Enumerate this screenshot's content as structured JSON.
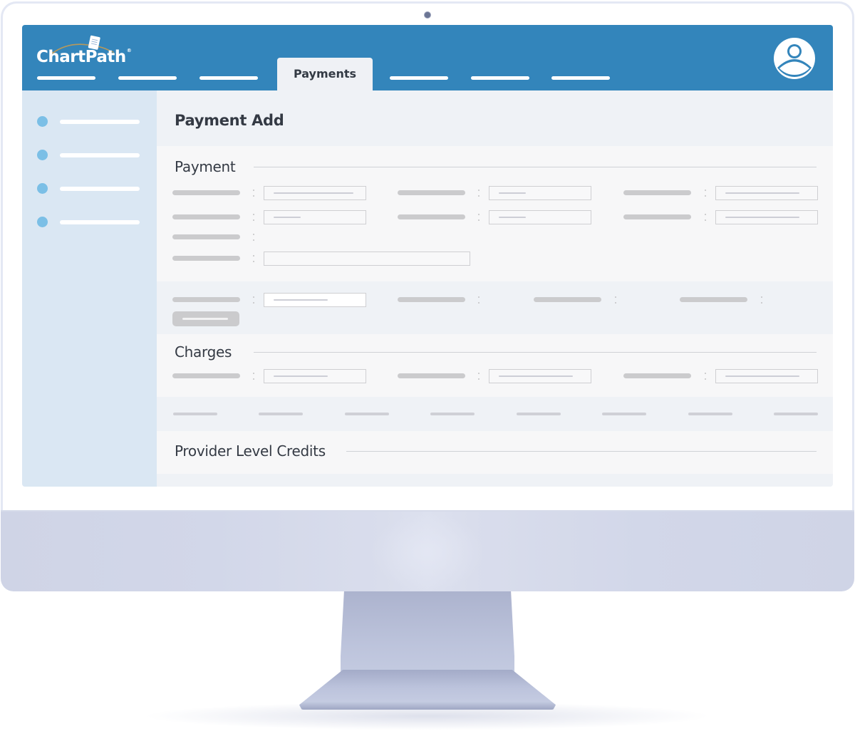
{
  "app": {
    "brand": "ChartPath",
    "brand_mark": "®",
    "colors": {
      "header": "#3385bb",
      "sidebar": "#dae7f3",
      "sidebar_dot": "#7bbfe6",
      "content_bg": "#eff2f6",
      "panel_bg": "#f7f7f8",
      "text_dark": "#343a44",
      "placeholder_bar": "#cbcbcd"
    }
  },
  "header": {
    "nav_tabs": [
      {
        "label": "",
        "placeholder": true
      },
      {
        "label": "",
        "placeholder": true
      },
      {
        "label": "",
        "placeholder": true
      },
      {
        "label": "Payments",
        "active": true
      },
      {
        "label": "",
        "placeholder": true
      },
      {
        "label": "",
        "placeholder": true
      },
      {
        "label": "",
        "placeholder": true
      }
    ],
    "active_tab": "Payments",
    "user_icon": "user-avatar-icon"
  },
  "sidebar": {
    "items": [
      {
        "icon": "bullet-dot",
        "label": ""
      },
      {
        "icon": "bullet-dot",
        "label": ""
      },
      {
        "icon": "bullet-dot",
        "label": ""
      },
      {
        "icon": "bullet-dot",
        "label": ""
      }
    ]
  },
  "main": {
    "page_title": "Payment Add",
    "sections": {
      "payment": {
        "title": "Payment",
        "rows": 4,
        "fields_per_row": [
          3,
          3,
          1,
          1
        ]
      },
      "allocation": {
        "fields": 4,
        "button_label": ""
      },
      "charges": {
        "title": "Charges",
        "fields": 3
      },
      "charges_table": {
        "columns": [
          "",
          "",
          "",
          "",
          "",
          "",
          "",
          ""
        ]
      },
      "provider_level_credits": {
        "title": "Provider Level Credits"
      }
    }
  }
}
